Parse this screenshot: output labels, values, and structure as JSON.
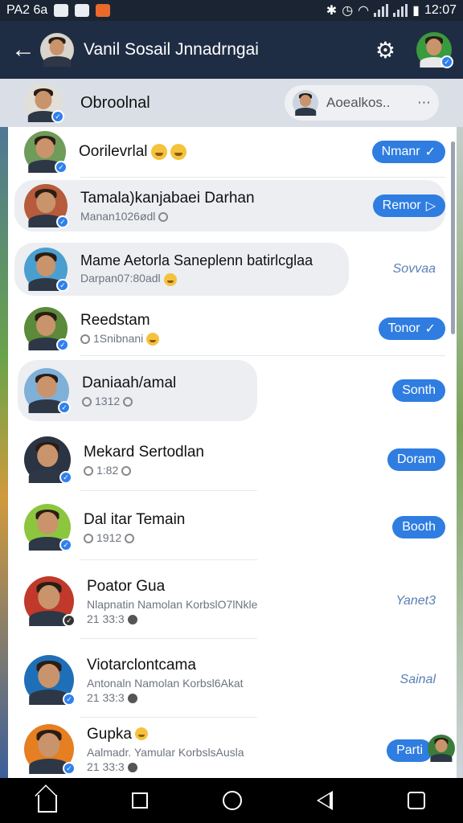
{
  "status_bar": {
    "left_text": "PA2 6a",
    "time": "12:07"
  },
  "header": {
    "title": "Vanil Sosail Jnnadrngai"
  },
  "pinned": {
    "name": "Obroolnal",
    "pill_text": "Aoealkos..",
    "pill_more": "⋯"
  },
  "rows": [
    {
      "name": "Oorilevrlal",
      "button": "Nmanr",
      "button_style": "filled"
    },
    {
      "name": "Tamala)kanjabaei Darhan",
      "sub": "Manan1026ødl",
      "button": "Remor",
      "button_style": "filled"
    },
    {
      "name": "Mame Aetorla Saneplenn batirlcglaa",
      "sub": "Darpan07:80adl",
      "button": "Sovvaa",
      "button_style": "ghost"
    },
    {
      "name": "Reedstam",
      "sub": "1Snibnani",
      "button": "Tonor",
      "button_style": "filled"
    },
    {
      "name": "Daniaah/amal",
      "sub": "1312",
      "button": "Sonth",
      "button_style": "filled"
    },
    {
      "name": "Mekard Sertodlan",
      "sub": "1:82",
      "button": "Doram",
      "button_style": "filled"
    },
    {
      "name": "Dal itar Temain",
      "sub": "1912",
      "button": "Booth",
      "button_style": "filled"
    },
    {
      "name": "Poator Gua",
      "sub": "Nlapnatin Namolan KorbslO7lNkle",
      "sub2": "21 33:3",
      "button": "Yanet3",
      "button_style": "ghost"
    },
    {
      "name": "Viotarclontcama",
      "sub": "Antonaln Namolan Korbsl6Akat",
      "sub2": "21 33:3",
      "button": "Sainal",
      "button_style": "ghost"
    },
    {
      "name": "Gupka",
      "sub": "Aalmadr. Yamular KorbslsAusla",
      "sub2": "21 33:3",
      "button": "Parti",
      "button_style": "filled"
    }
  ],
  "colors": {
    "header_bg": "#1f2d44",
    "accent": "#2f7de1",
    "status_bg": "#1b2433"
  },
  "icons": {
    "back": "arrow-left-icon",
    "settings": "gear-icon",
    "verified": "verified-badge-icon"
  }
}
